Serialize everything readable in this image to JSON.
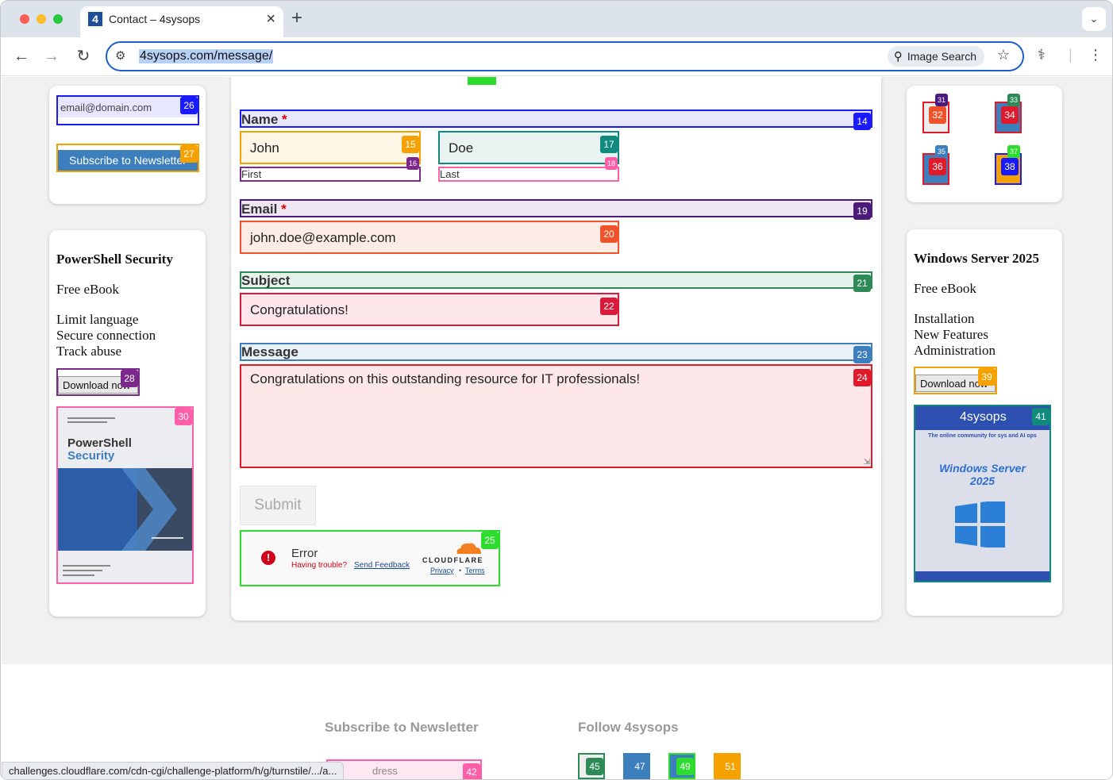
{
  "browser": {
    "tab_title": "Contact – 4sysops",
    "tab_favicon": "4",
    "url": "4sysops.com/message/",
    "image_search_label": "Image Search"
  },
  "left_sidebar": {
    "newsletter_email_placeholder": "email@domain.com",
    "subscribe_button": "Subscribe to Newsletter",
    "promo": {
      "title": "PowerShell Security",
      "subtitle": "Free eBook",
      "features": [
        "Limit language",
        "Secure connection",
        "Track abuse"
      ],
      "download_button": "Download now",
      "cover_title_line1": "PowerShell",
      "cover_title_line2": "Security"
    }
  },
  "right_sidebar": {
    "promo": {
      "title": "Windows Server 2025",
      "subtitle": "Free eBook",
      "features": [
        "Installation",
        "New Features",
        "Administration"
      ],
      "download_button": "Download now",
      "cover_logo": "4sysops",
      "cover_tagline": "The online community for sys and AI ops",
      "cover_title_line1": "Windows Server",
      "cover_title_line2": "2025"
    }
  },
  "form": {
    "name_label": "Name",
    "first_name_value": "John",
    "first_sublabel": "First",
    "last_name_value": "Doe",
    "last_sublabel": "Last",
    "email_label": "Email",
    "email_value": "john.doe@example.com",
    "subject_label": "Subject",
    "subject_value": "Congratulations!",
    "message_label": "Message",
    "message_value": "Congratulations on this outstanding resource for IT professionals!",
    "required_mark": "*",
    "submit_button": "Submit"
  },
  "turnstile": {
    "status": "Error",
    "trouble_text": "Having trouble?",
    "feedback_link": "Send Feedback",
    "brand": "CLOUDFLARE",
    "privacy_link": "Privacy",
    "separator": "•",
    "terms_link": "Terms"
  },
  "footer": {
    "newsletter_title": "Subscribe to Newsletter",
    "follow_title": "Follow 4sysops",
    "email_placeholder_partial": "dress"
  },
  "status_url": "challenges.cloudflare.com/cdn-cgi/challenge-platform/h/g/turnstile/.../a...",
  "badges": {
    "b14": "14",
    "b15": "15",
    "b16": "16",
    "b17": "17",
    "b18": "18",
    "b19": "19",
    "b20": "20",
    "b21": "21",
    "b22": "22",
    "b23": "23",
    "b24": "24",
    "b25": "25",
    "b26": "26",
    "b27": "27",
    "b28": "28",
    "b30": "30",
    "b31": "31",
    "b32": "32",
    "b33": "33",
    "b34": "34",
    "b35": "35",
    "b36": "36",
    "b37": "37",
    "b38": "38",
    "b39": "39",
    "b41": "41",
    "b42": "42",
    "b45": "45",
    "b47": "47",
    "b49": "49",
    "b51": "51"
  },
  "colors": {
    "accent_blue": "#1a5fc8",
    "required_red": "#dd0000",
    "cloudflare_orange": "#f38020"
  }
}
